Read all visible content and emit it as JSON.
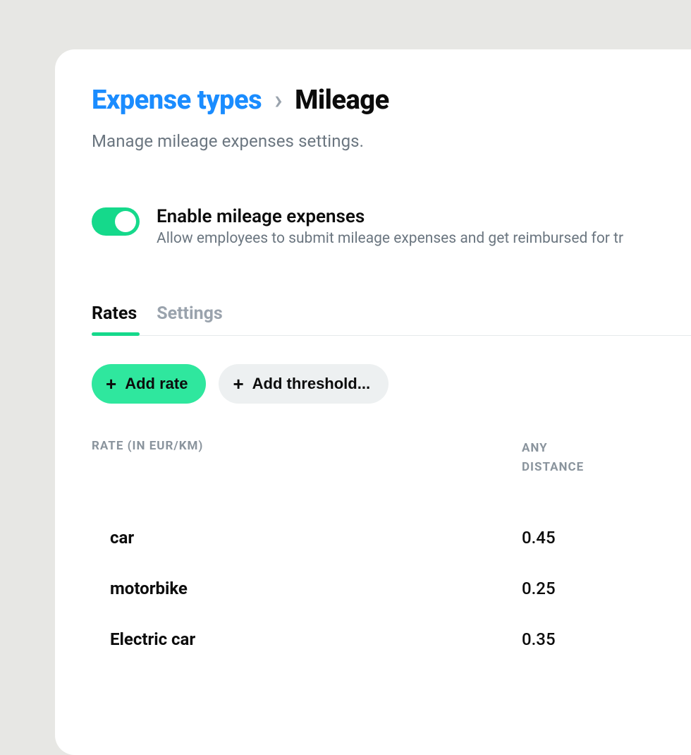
{
  "breadcrumb": {
    "parent": "Expense types",
    "chevron": "›",
    "current": "Mileage"
  },
  "subtitle": "Manage mileage expenses settings.",
  "toggle": {
    "enabled": true,
    "title": "Enable mileage expenses",
    "description": "Allow employees to submit mileage expenses and get reimbursed for tr"
  },
  "tabs": {
    "rates": "Rates",
    "settings": "Settings",
    "active": "rates"
  },
  "actions": {
    "add_rate": "Add rate",
    "add_threshold": "Add threshold..."
  },
  "table": {
    "header_rate": "RATE (IN EUR/KM)",
    "header_distance_l1": "ANY",
    "header_distance_l2": "DISTANCE",
    "rows": [
      {
        "name": "car",
        "value": "0.45"
      },
      {
        "name": "motorbike",
        "value": "0.25"
      },
      {
        "name": "Electric car",
        "value": "0.35"
      }
    ]
  }
}
